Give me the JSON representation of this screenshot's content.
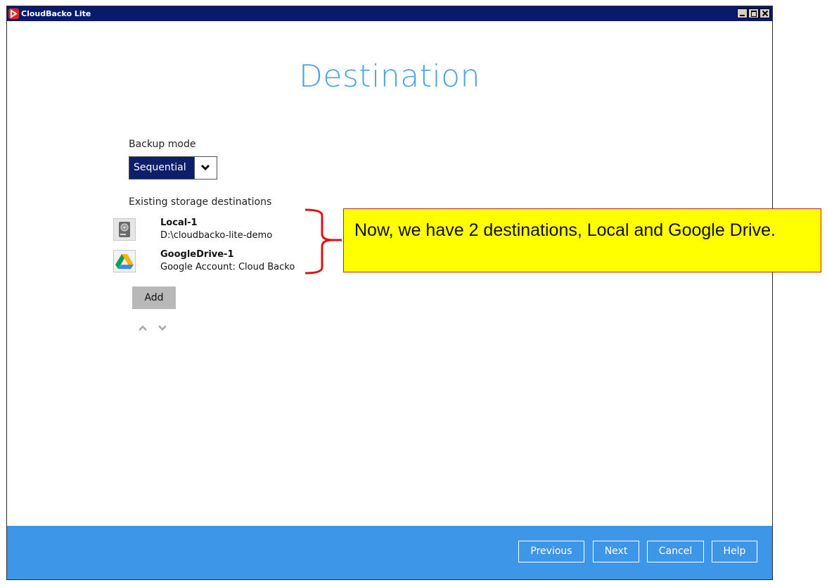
{
  "window": {
    "title": "CloudBacko Lite",
    "controls": [
      "minimize",
      "maximize",
      "close"
    ]
  },
  "page": {
    "title": "Destination",
    "backup_mode_label": "Backup mode",
    "backup_mode_value": "Sequential",
    "existing_label": "Existing storage destinations",
    "destinations": [
      {
        "name": "Local-1",
        "detail": "D:\\cloudbacko-lite-demo",
        "icon": "hard-drive-icon"
      },
      {
        "name": "GoogleDrive-1",
        "detail": "Google Account: Cloud Backo",
        "icon": "google-drive-icon"
      }
    ],
    "add_label": "Add"
  },
  "footer": {
    "previous": "Previous",
    "next": "Next",
    "cancel": "Cancel",
    "help": "Help"
  },
  "annotation": {
    "text": "Now, we have 2 destinations, Local and Google Drive."
  },
  "colors": {
    "title_bar": "#0a1a6a",
    "heading": "#4aa3e8",
    "select_bg": "#0d1f6b",
    "footer": "#3d96e8",
    "callout_bg": "#ffff00",
    "callout_border": "#c02020"
  }
}
